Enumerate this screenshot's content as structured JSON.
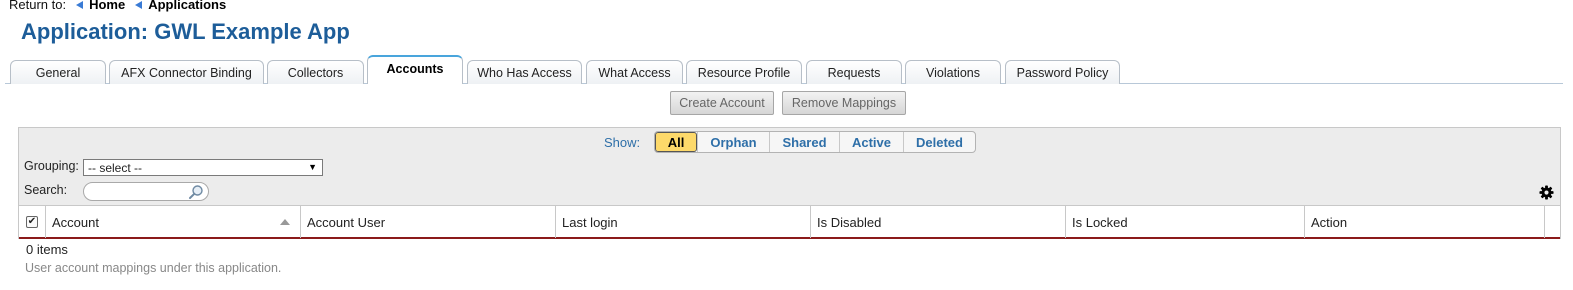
{
  "breadcrumb": {
    "label": "Return to:",
    "items": [
      "Home",
      "Applications"
    ]
  },
  "page": {
    "title": "Application: GWL Example App"
  },
  "tabs": [
    {
      "label": "General"
    },
    {
      "label": "AFX Connector Binding"
    },
    {
      "label": "Collectors"
    },
    {
      "label": "Accounts",
      "active": true
    },
    {
      "label": "Who Has Access"
    },
    {
      "label": "What Access"
    },
    {
      "label": "Resource Profile"
    },
    {
      "label": "Requests"
    },
    {
      "label": "Violations"
    },
    {
      "label": "Password Policy"
    }
  ],
  "toolbar": {
    "create_label": "Create Account",
    "remove_label": "Remove Mappings"
  },
  "filters": {
    "show_label": "Show:",
    "options": [
      "All",
      "Orphan",
      "Shared",
      "Active",
      "Deleted"
    ],
    "selected": "All",
    "selected_color": "#fdd96a"
  },
  "grouping": {
    "label": "Grouping:",
    "value": "-- select --"
  },
  "search": {
    "label": "Search:",
    "value": "",
    "placeholder": ""
  },
  "table": {
    "columns": [
      "Account",
      "Account User",
      "Last login",
      "Is Disabled",
      "Is Locked",
      "Action"
    ],
    "sorted_column": "Account",
    "sort_direction": "ascending",
    "rows": []
  },
  "footer": {
    "count_text": "0 items",
    "description": "User account mappings under this application."
  },
  "colors": {
    "title": "#1d5d99",
    "link": "#2e6fa8",
    "header_rule": "#8b1a1a",
    "active_tab_accent": "#49a5dc"
  },
  "icons": {
    "breadcrumb": "arrow-left-icon",
    "search": "search-icon",
    "settings": "gear-icon",
    "sort": "sort-ascending-icon",
    "select": "chevron-down-icon"
  }
}
